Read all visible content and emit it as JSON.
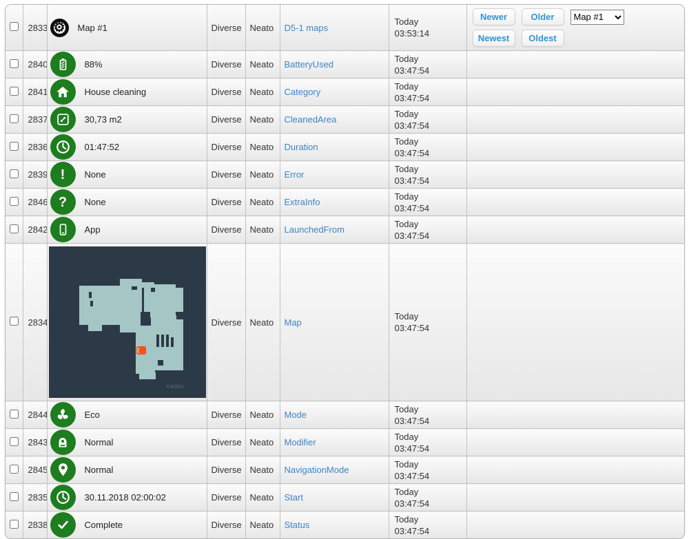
{
  "table": {
    "map_watermark": "neato",
    "rows": [
      {
        "id": "2833",
        "icon": "gear-icon",
        "value": "Map #1",
        "type": "Diverse",
        "hardware": "Neato",
        "name": "D5-1 maps",
        "time_line1": "Today",
        "time_line2": "03:53:14",
        "has_actions": true
      },
      {
        "id": "2840",
        "icon": "battery-icon",
        "value": "88%",
        "type": "Diverse",
        "hardware": "Neato",
        "name": "BatteryUsed",
        "time_line1": "Today",
        "time_line2": "03:47:54"
      },
      {
        "id": "2841",
        "icon": "house-icon",
        "value": "House cleaning",
        "type": "Diverse",
        "hardware": "Neato",
        "name": "Category",
        "time_line1": "Today",
        "time_line2": "03:47:54"
      },
      {
        "id": "2837",
        "icon": "expand-icon",
        "value": "30,73 m2",
        "type": "Diverse",
        "hardware": "Neato",
        "name": "CleanedArea",
        "time_line1": "Today",
        "time_line2": "03:47:54"
      },
      {
        "id": "2836",
        "icon": "clock-icon",
        "value": "01:47:52",
        "type": "Diverse",
        "hardware": "Neato",
        "name": "Duration",
        "time_line1": "Today",
        "time_line2": "03:47:54"
      },
      {
        "id": "2839",
        "icon": "exclamation-icon",
        "value": "None",
        "type": "Diverse",
        "hardware": "Neato",
        "name": "Error",
        "time_line1": "Today",
        "time_line2": "03:47:54"
      },
      {
        "id": "2846",
        "icon": "question-icon",
        "value": "None",
        "type": "Diverse",
        "hardware": "Neato",
        "name": "ExtraInfo",
        "time_line1": "Today",
        "time_line2": "03:47:54"
      },
      {
        "id": "2842",
        "icon": "phone-icon",
        "value": "App",
        "type": "Diverse",
        "hardware": "Neato",
        "name": "LaunchedFrom",
        "time_line1": "Today",
        "time_line2": "03:47:54"
      },
      {
        "id": "2834",
        "icon": "map-image",
        "value": "",
        "type": "Diverse",
        "hardware": "Neato",
        "name": "Map",
        "time_line1": "Today",
        "time_line2": "03:47:54",
        "is_map": true
      },
      {
        "id": "2844",
        "icon": "fan-icon",
        "value": "Eco",
        "type": "Diverse",
        "hardware": "Neato",
        "name": "Mode",
        "time_line1": "Today",
        "time_line2": "03:47:54"
      },
      {
        "id": "2843",
        "icon": "robot-icon",
        "value": "Normal",
        "type": "Diverse",
        "hardware": "Neato",
        "name": "Modifier",
        "time_line1": "Today",
        "time_line2": "03:47:54"
      },
      {
        "id": "2845",
        "icon": "pin-icon",
        "value": "Normal",
        "type": "Diverse",
        "hardware": "Neato",
        "name": "NavigationMode",
        "time_line1": "Today",
        "time_line2": "03:47:54"
      },
      {
        "id": "2835",
        "icon": "clock-icon",
        "value": "30.11.2018 02:00:02",
        "type": "Diverse",
        "hardware": "Neato",
        "name": "Start",
        "time_line1": "Today",
        "time_line2": "03:47:54"
      },
      {
        "id": "2838",
        "icon": "check-icon",
        "value": "Complete",
        "type": "Diverse",
        "hardware": "Neato",
        "name": "Status",
        "time_line1": "Today",
        "time_line2": "03:47:54"
      }
    ],
    "actions": {
      "buttons": [
        "Newer",
        "Older",
        "Newest",
        "Oldest"
      ],
      "map_select": {
        "selected": "Map #1",
        "options": [
          "Map #1"
        ]
      }
    }
  },
  "colors": {
    "icon_green": "#1e7d1e",
    "link_blue": "#3d85c6",
    "button_blue": "#2f96d2",
    "map_background": "#2c3947",
    "map_floor": "#a4c6c4",
    "map_marker_orange": "#f2541a"
  }
}
